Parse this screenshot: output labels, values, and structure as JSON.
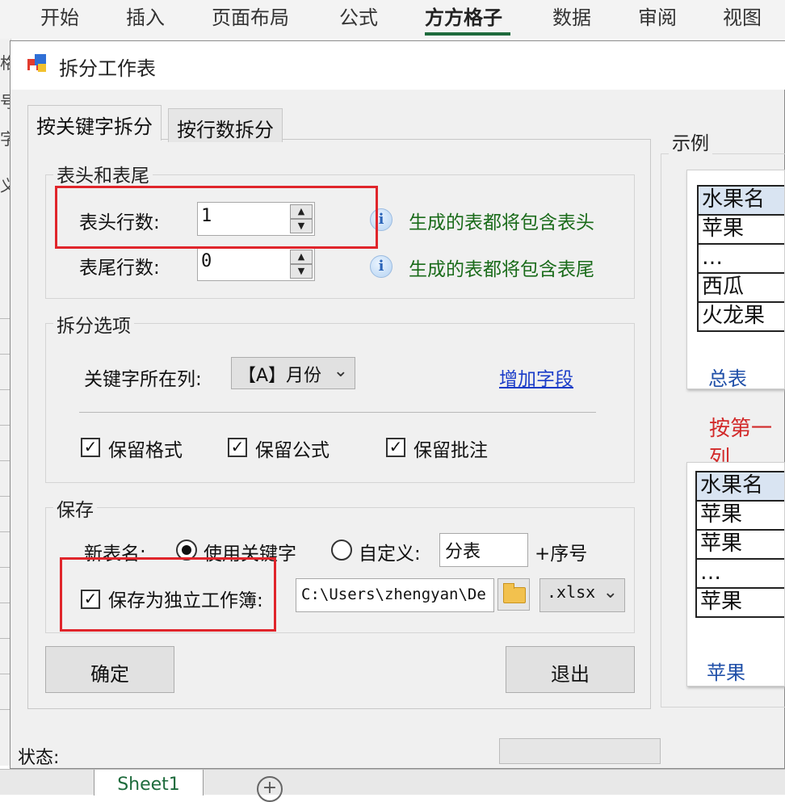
{
  "ribbon": {
    "tabs": [
      "开始",
      "插入",
      "页面布局",
      "公式",
      "方方格子",
      "数据",
      "审阅",
      "视图"
    ],
    "active_tab": "方方格子"
  },
  "left_strip": {
    "chars": [
      "格",
      "号",
      "字",
      "义"
    ]
  },
  "dialog": {
    "title": "拆分工作表",
    "tabs": [
      "按关键字拆分",
      "按行数拆分"
    ],
    "header_footer": {
      "legend": "表头和表尾",
      "header_rows_label": "表头行数:",
      "header_rows_value": "1",
      "header_hint": "生成的表都将包含表头",
      "footer_rows_label": "表尾行数:",
      "footer_rows_value": "0",
      "footer_hint": "生成的表都将包含表尾"
    },
    "split_options": {
      "legend": "拆分选项",
      "key_column_label": "关键字所在列:",
      "key_column_value": "【A】月份",
      "add_field_link": "增加字段",
      "keep_format": "保留格式",
      "keep_formula": "保留公式",
      "keep_comment": "保留批注"
    },
    "save": {
      "legend": "保存",
      "new_name_label": "新表名:",
      "use_keyword": "使用关键字",
      "custom": "自定义:",
      "custom_value": "分表",
      "suffix": "+序号",
      "save_as_workbook": "保存为独立工作簿:",
      "path": "C:\\Users\\zhengyan\\De",
      "ext": ".xlsx"
    },
    "ok_label": "确定",
    "exit_label": "退出",
    "status_label": "状态:",
    "example": {
      "legend": "示例",
      "top_table": [
        "水果名",
        "苹果",
        "…",
        "西瓜",
        "火龙果"
      ],
      "top_tab": "总表",
      "caption": "按第一列",
      "bottom_table": [
        "水果名",
        "苹果",
        "苹果",
        "…",
        "苹果"
      ],
      "bottom_tab": "苹果"
    }
  },
  "sheetbar": {
    "sheet_name": "Sheet1",
    "add_icon": "+"
  }
}
